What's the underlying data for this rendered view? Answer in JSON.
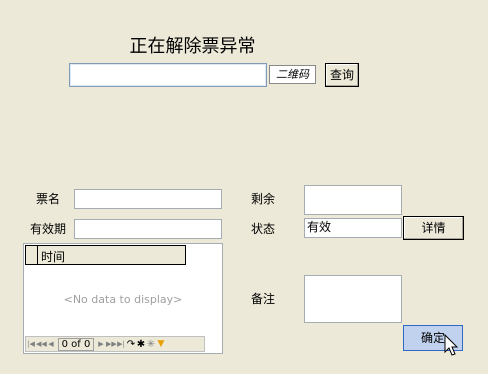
{
  "title": "正在解除票异常",
  "search": {
    "value": "",
    "qr_label": "二维码",
    "query_label": "查询"
  },
  "fields": {
    "ticket_name": {
      "label": "票名",
      "value": ""
    },
    "validity": {
      "label": "有效期",
      "value": ""
    },
    "remaining": {
      "label": "剩余",
      "value": ""
    },
    "status": {
      "label": "状态",
      "value": "有效",
      "detail_label": "详情"
    },
    "remark": {
      "label": "备注",
      "value": ""
    }
  },
  "grid": {
    "columns": [
      "时间"
    ],
    "empty_text": "<No data to display>",
    "pager_text": "0 of 0"
  },
  "ok_label": "确定",
  "icons": {
    "nav": [
      "first-icon",
      "prev-page-icon",
      "prev-icon",
      "next-icon",
      "next-page-icon",
      "last-icon",
      "refresh-icon",
      "add-icon",
      "clear-icon",
      "filter-icon"
    ]
  }
}
